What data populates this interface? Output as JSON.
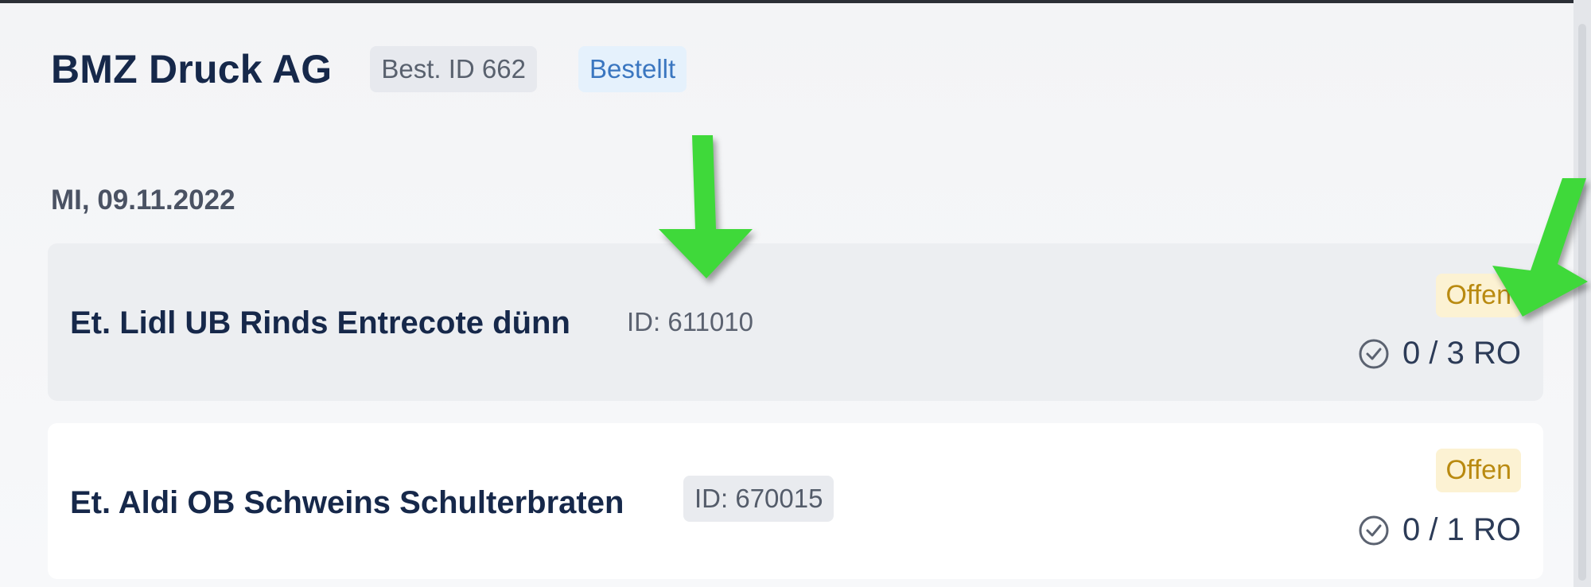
{
  "top_clip_text": "",
  "header": {
    "title": "BMZ Druck AG",
    "order_id": "Best. ID 662",
    "status": "Bestellt"
  },
  "date_label": "MI, 09.11.2022",
  "items": [
    {
      "title": "Et. Lidl UB Rinds Entrecote dünn",
      "id_label": "ID: 611010",
      "status": "Offen",
      "progress": "0 / 3 RO"
    },
    {
      "title": "Et. Aldi OB Schweins Schulterbraten",
      "id_label": "ID: 670015",
      "status": "Offen",
      "progress": "0 / 1 RO"
    }
  ],
  "annotations": {
    "arrow_color": "#3fd93a",
    "arrows": [
      "down-arrow-annotation",
      "down-left-arrow-annotation"
    ]
  },
  "colors": {
    "title_text": "#16284a",
    "status_blue": "#3a76c0",
    "status_blue_bg": "#e5f1fc",
    "offen_text": "#b98a10",
    "offen_bg": "#fcf2d3"
  }
}
